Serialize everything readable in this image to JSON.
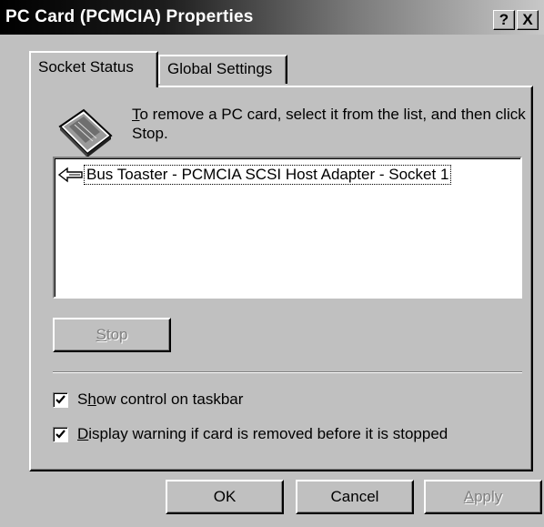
{
  "window": {
    "title": "PC Card (PCMCIA) Properties",
    "help_glyph": "?",
    "close_glyph": "X"
  },
  "tabs": [
    {
      "label": "Socket Status",
      "active": true
    },
    {
      "label": "Global Settings",
      "active": false
    }
  ],
  "instruction": {
    "mnemonic": "T",
    "rest": "o remove a PC card, select it from the list, and then click Stop."
  },
  "devices": [
    {
      "label": "Bus Toaster - PCMCIA SCSI Host Adapter - Socket 1",
      "icon": "pc-card-device-icon"
    }
  ],
  "buttons": {
    "stop": {
      "mnemonic": "S",
      "rest": "top",
      "enabled": false
    },
    "ok": {
      "label": "OK"
    },
    "cancel": {
      "label": "Cancel"
    },
    "apply": {
      "mnemonic": "A",
      "rest": "pply",
      "enabled": false
    }
  },
  "checkboxes": [
    {
      "pre": "S",
      "mnemonic": "h",
      "rest": "ow control on taskbar",
      "checked": true
    },
    {
      "pre": "",
      "mnemonic": "D",
      "rest": "isplay warning if card is removed before it is stopped",
      "checked": true
    }
  ],
  "colors": {
    "face": "#c0c0c0",
    "highlight": "#ffffff",
    "shadow": "#808080",
    "dark_shadow": "#000000",
    "window_bg": "#ffffff"
  }
}
